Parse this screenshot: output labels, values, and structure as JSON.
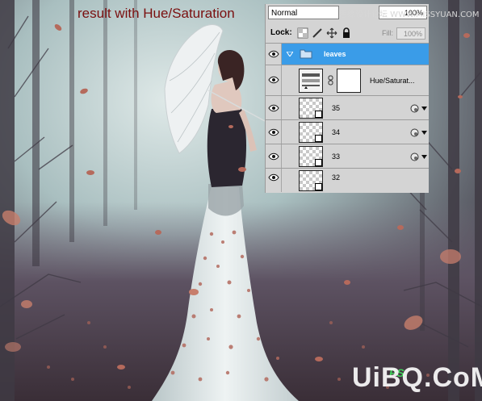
{
  "caption": "result with Hue/Saturation",
  "panel": {
    "blend_mode": "Normal",
    "opacity_value": "100%",
    "lock_label": "Lock:",
    "fill_label": "Fill:",
    "fill_value": "100%",
    "layers": [
      {
        "name": "leaves",
        "kind": "group",
        "selected": true
      },
      {
        "name": "Hue/Saturat...",
        "kind": "adjustment"
      },
      {
        "name": "35",
        "kind": "smart-object"
      },
      {
        "name": "34",
        "kind": "smart-object"
      },
      {
        "name": "33",
        "kind": "smart-object"
      },
      {
        "name": "32",
        "kind": "smart-object"
      }
    ]
  },
  "watermarks": {
    "top": "思缘设计论坛 WWW.MISSYUAN.COM",
    "ps_logo": "PS",
    "bottom": "UiBQ.CoM"
  },
  "colors": {
    "caption": "#7a0f0f",
    "selected_layer": "#3a9ce8",
    "panel_bg": "#d4d4d4",
    "fog": "#c9dada",
    "dress": "#e8eeee",
    "leaf": "#b56a5c"
  },
  "icons": [
    "eye-icon",
    "folder-icon",
    "disclosure-triangle-icon",
    "chain-link-icon",
    "lock-transparency-icon",
    "lock-paint-icon",
    "lock-move-icon",
    "lock-all-icon",
    "layer-style-icon",
    "umbrella"
  ]
}
